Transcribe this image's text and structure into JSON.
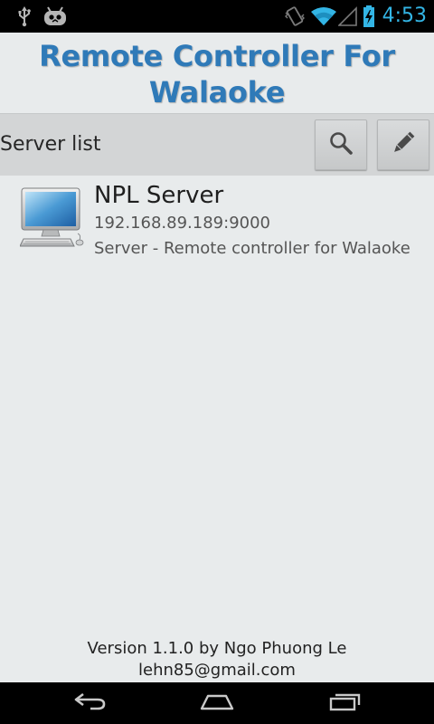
{
  "status_bar": {
    "time": "4:53",
    "left_icons": [
      "usb-icon",
      "android-debug-icon"
    ],
    "right_icons": [
      "vibrate-icon",
      "wifi-icon",
      "signal-icon",
      "battery-charging-icon"
    ],
    "time_color": "#33b5e5"
  },
  "app": {
    "title": "Remote Controller For Walaoke",
    "title_color": "#2f7ab8"
  },
  "toolbar": {
    "title": "Server list",
    "search_icon": "search-icon",
    "edit_icon": "pencil-icon"
  },
  "servers": [
    {
      "name": "NPL Server",
      "address": "192.168.89.189:9000",
      "description": "Server - Remote controller for Walaoke",
      "icon": "computer-icon"
    }
  ],
  "footer": {
    "version": "Version 1.1.0 by Ngo Phuong Le",
    "email": "lehn85@gmail.com"
  },
  "nav_bar": {
    "buttons": [
      "back-icon",
      "home-icon",
      "recents-icon"
    ]
  }
}
